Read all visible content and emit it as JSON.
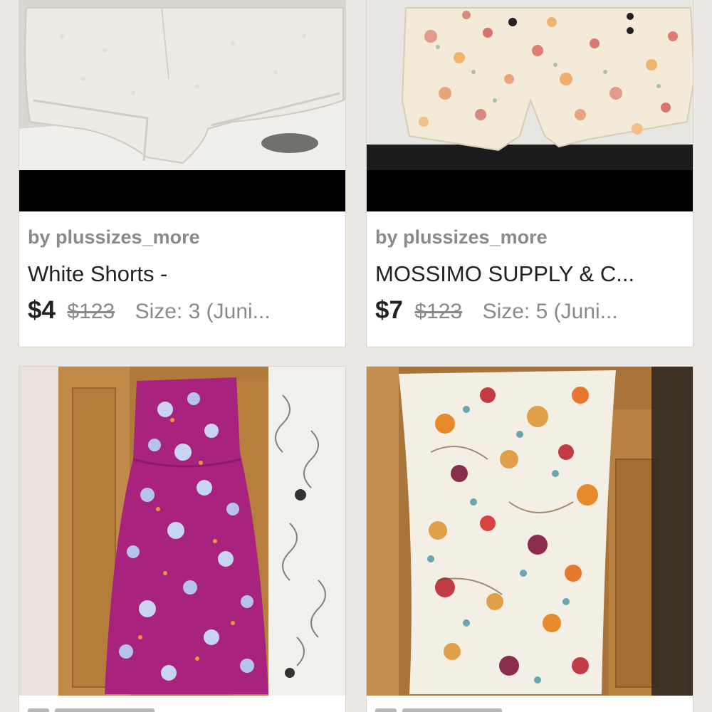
{
  "listings": [
    {
      "seller": "by plussizes_more",
      "title": "White Shorts -",
      "price": "$4",
      "original_price": "$123",
      "size": "Size: 3 (Juni...",
      "image": "white-shorts-photo"
    },
    {
      "seller": "by plussizes_more",
      "title": "MOSSIMO SUPPLY & C...",
      "price": "$7",
      "original_price": "$123",
      "size": "Size: 5 (Juni...",
      "image": "floral-shorts-photo"
    },
    {
      "image": "magenta-floral-dress-photo"
    },
    {
      "image": "floral-strapless-dress-photo"
    }
  ],
  "colors": {
    "background": "#ece9e4",
    "card": "#ffffff",
    "muted_text": "#8a8a8a",
    "primary_text": "#222222"
  }
}
